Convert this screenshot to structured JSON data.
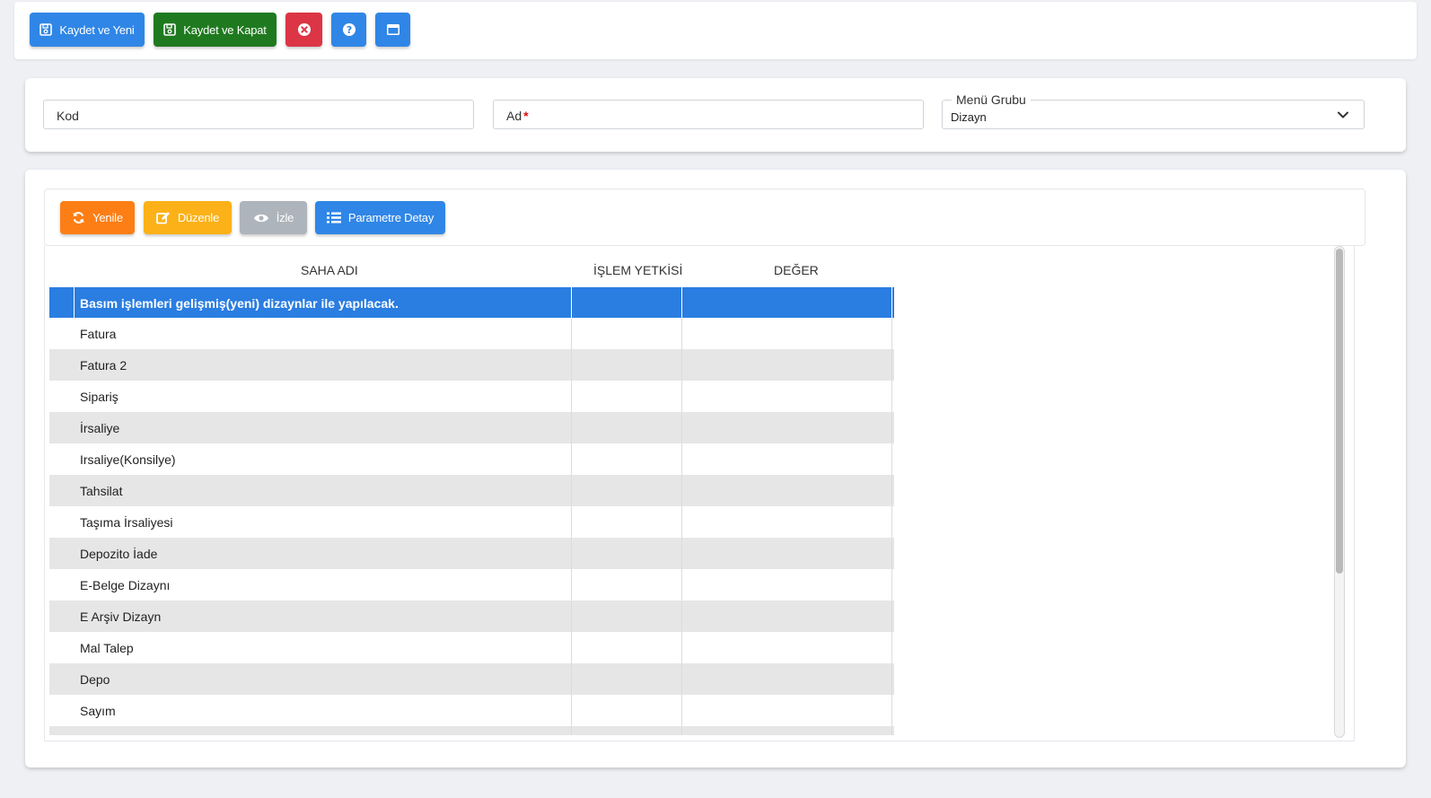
{
  "toolbar": {
    "save_new_label": "Kaydet ve Yeni",
    "save_close_label": "Kaydet ve Kapat",
    "colors": {
      "blue": "#2f86e6",
      "green": "#1f7a1f",
      "red": "#dc3545"
    }
  },
  "form": {
    "kod_label": "Kod",
    "ad_label": "Ad",
    "required_mark": "*",
    "menu_group_label": "Menü Grubu",
    "menu_group_value": "Dizayn"
  },
  "grid_toolbar": {
    "refresh_label": "Yenile",
    "edit_label": "Düzenle",
    "view_label": "İzle",
    "param_detail_label": "Parametre Detay",
    "colors": {
      "orange": "#fd7e14",
      "yellow": "#fbb117",
      "gray": "#aeb4bb",
      "blue": "#2f86e6"
    }
  },
  "table": {
    "columns": [
      "SAHA ADI",
      "İŞLEM YETKİSİ",
      "DEĞER"
    ],
    "rows": [
      "Basım işlemleri gelişmiş(yeni) dizaynlar ile yapılacak.",
      "Fatura",
      "Fatura 2",
      "Sipariş",
      "İrsaliye",
      "Irsaliye(Konsilye)",
      "Tahsilat",
      "Taşıma İrsaliyesi",
      "Depozito İade",
      "E-Belge Dizaynı",
      "E Arşiv Dizayn",
      "Mal Talep",
      "Depo",
      "Sayım"
    ],
    "selected_row": 0,
    "selected_color": "#2a7de1"
  }
}
